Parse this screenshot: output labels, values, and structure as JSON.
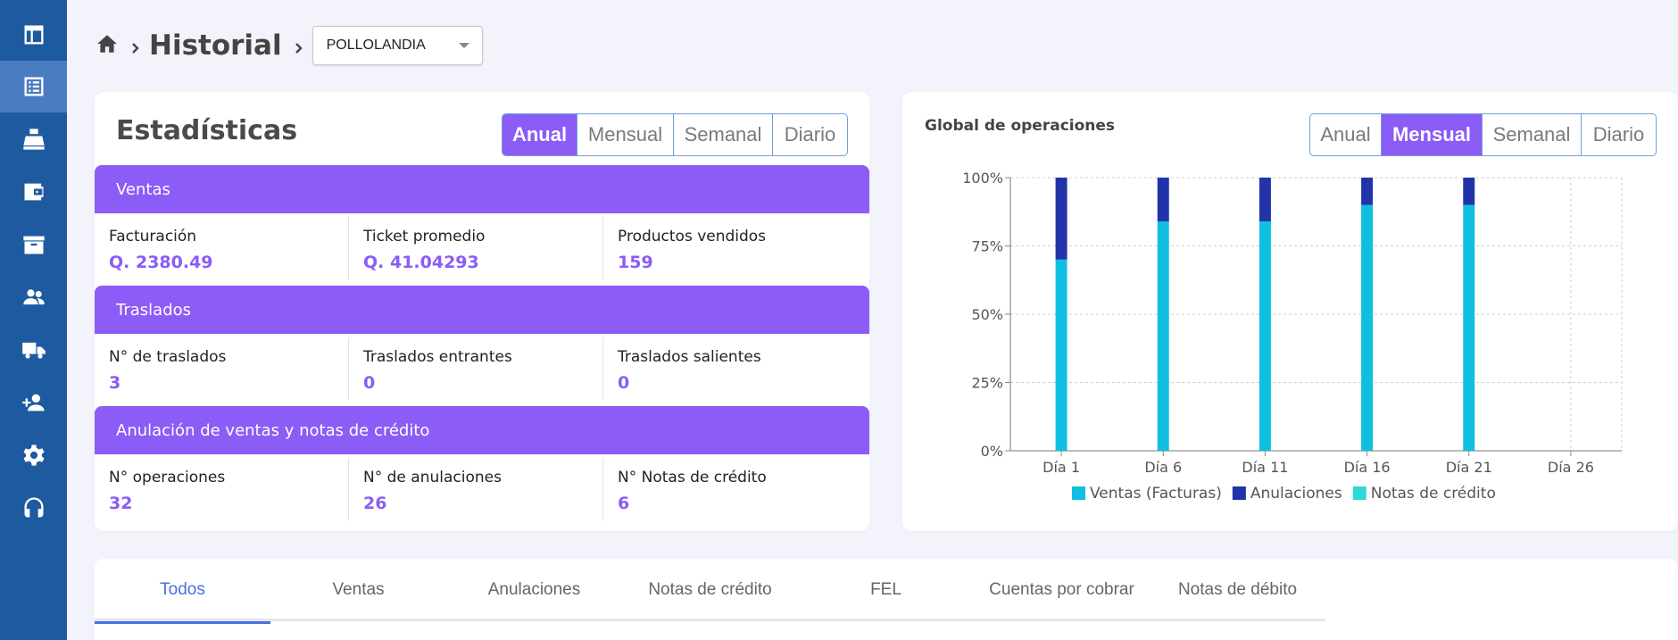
{
  "sidebar": {
    "items": [
      {
        "icon": "table-icon"
      },
      {
        "icon": "receipt-list-icon",
        "active": true
      },
      {
        "icon": "cash-register-icon"
      },
      {
        "icon": "wallet-icon"
      },
      {
        "icon": "archive-box-icon"
      },
      {
        "icon": "users-icon"
      },
      {
        "icon": "truck-icon"
      },
      {
        "icon": "add-user-icon"
      },
      {
        "icon": "gear-icon"
      },
      {
        "icon": "headset-icon"
      }
    ]
  },
  "header": {
    "title": "Historial",
    "branch_select": "POLLOLANDIA"
  },
  "stats": {
    "title": "Estadísticas",
    "periods": [
      "Anual",
      "Mensual",
      "Semanal",
      "Diario"
    ],
    "active_period": "Anual",
    "sections": [
      {
        "title": "Ventas",
        "metrics": [
          {
            "label": "Facturación",
            "value": "Q. 2380.49"
          },
          {
            "label": "Ticket promedio",
            "value": "Q. 41.04293"
          },
          {
            "label": "Productos vendidos",
            "value": "159"
          }
        ]
      },
      {
        "title": "Traslados",
        "metrics": [
          {
            "label": "N° de traslados",
            "value": "3"
          },
          {
            "label": "Traslados entrantes",
            "value": "0"
          },
          {
            "label": "Traslados salientes",
            "value": "0"
          }
        ]
      },
      {
        "title": "Anulación de ventas y notas de crédito",
        "metrics": [
          {
            "label": "N° operaciones",
            "value": "32"
          },
          {
            "label": "N° de anulaciones",
            "value": "26"
          },
          {
            "label": "N° Notas de crédito",
            "value": "6"
          }
        ]
      }
    ]
  },
  "chart": {
    "title": "Global de operaciones",
    "periods": [
      "Anual",
      "Mensual",
      "Semanal",
      "Diario"
    ],
    "active_period": "Mensual"
  },
  "chart_data": {
    "type": "bar",
    "stacked": true,
    "title": "Global de operaciones",
    "categories": [
      "Día 1",
      "Día 6",
      "Día 11",
      "Día 16",
      "Día 21",
      "Día 26"
    ],
    "yticks": [
      "0%",
      "25%",
      "50%",
      "75%",
      "100%"
    ],
    "ylim": [
      0,
      100
    ],
    "grid": true,
    "legend_position": "bottom",
    "series": [
      {
        "name": "Ventas (Facturas)",
        "color": "#0fbfe0",
        "values": [
          70,
          84,
          84,
          90,
          90,
          0
        ]
      },
      {
        "name": "Anulaciones",
        "color": "#2233aa",
        "values": [
          30,
          16,
          16,
          10,
          10,
          0
        ]
      },
      {
        "name": "Notas de crédito",
        "color": "#2ed8d8",
        "values": [
          0,
          0,
          0,
          0,
          0,
          0
        ]
      }
    ]
  },
  "tabs": [
    "Todos",
    "Ventas",
    "Anulaciones",
    "Notas de crédito",
    "FEL",
    "Cuentas por cobrar",
    "Notas de débito"
  ],
  "active_tab": "Todos",
  "colors": {
    "sidebar": "#1e5aa0",
    "accent": "#8b5cf6",
    "tab_active": "#4a6fe3"
  }
}
